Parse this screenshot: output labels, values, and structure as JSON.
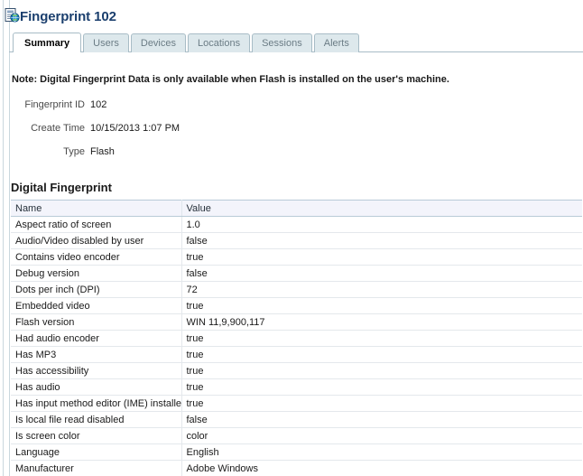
{
  "header": {
    "icon": "document-globe-icon",
    "title": "Fingerprint 102"
  },
  "tabs": [
    {
      "label": "Summary",
      "active": true
    },
    {
      "label": "Users",
      "active": false
    },
    {
      "label": "Devices",
      "active": false
    },
    {
      "label": "Locations",
      "active": false
    },
    {
      "label": "Sessions",
      "active": false
    },
    {
      "label": "Alerts",
      "active": false
    }
  ],
  "summary": {
    "note": "Note: Digital Fingerprint Data is only available when Flash is installed on the user's machine.",
    "fields": [
      {
        "label": "Fingerprint ID",
        "value": "102"
      },
      {
        "label": "Create Time",
        "value": "10/15/2013 1:07 PM"
      },
      {
        "label": "Type",
        "value": "Flash"
      }
    ]
  },
  "fingerprint_section": {
    "heading": "Digital Fingerprint",
    "columns": [
      "Name",
      "Value"
    ],
    "rows": [
      {
        "name": "Aspect ratio of screen",
        "value": "1.0"
      },
      {
        "name": "Audio/Video disabled by user",
        "value": "false"
      },
      {
        "name": "Contains video encoder",
        "value": "true"
      },
      {
        "name": "Debug version",
        "value": "false"
      },
      {
        "name": "Dots per inch (DPI)",
        "value": "72"
      },
      {
        "name": "Embedded video",
        "value": "true"
      },
      {
        "name": "Flash version",
        "value": "WIN 11,9,900,117"
      },
      {
        "name": "Had audio encoder",
        "value": "true"
      },
      {
        "name": "Has MP3",
        "value": "true"
      },
      {
        "name": "Has accessibility",
        "value": "true"
      },
      {
        "name": "Has audio",
        "value": "true"
      },
      {
        "name": "Has input method editor (IME) installed",
        "value": "true"
      },
      {
        "name": "Is local file read disabled",
        "value": "false"
      },
      {
        "name": "Is screen color",
        "value": "color"
      },
      {
        "name": "Language",
        "value": "English"
      },
      {
        "name": "Manufacturer",
        "value": "Adobe Windows"
      }
    ]
  },
  "colors": {
    "title": "#1b3f6e",
    "tab_border": "#a8bcc6",
    "tab_inactive_bg": "#dde8ec",
    "table_header_bg": "#f3f4fb",
    "table_header_border": "#b9cbd8",
    "rail": "#c9d7de"
  }
}
